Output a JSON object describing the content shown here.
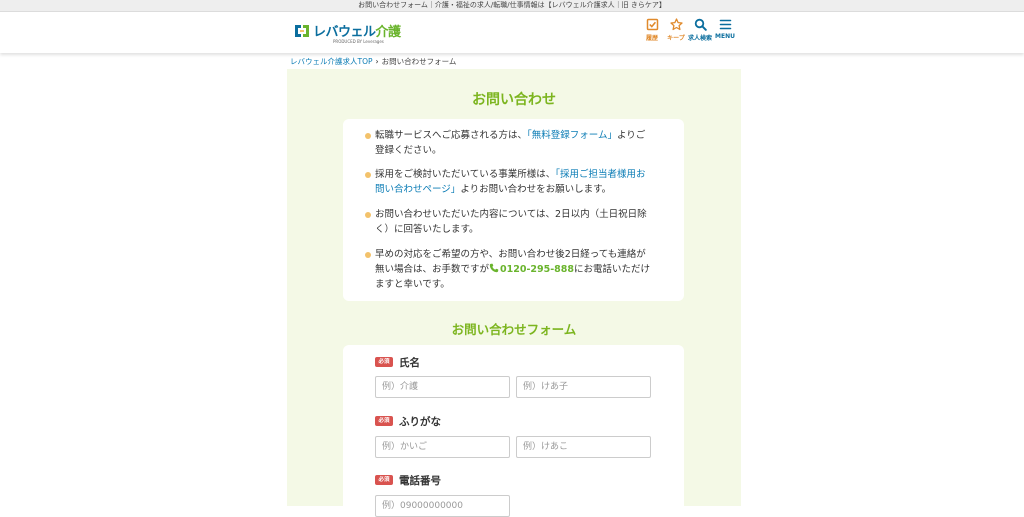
{
  "browser_title": "お問い合わせフォーム｜介護・福祉の求人/転職/仕事情報は【レバウェル介護求人｜旧 きらケア】",
  "header": {
    "logo_text_main": "レバウェル",
    "logo_text_accent": "介護",
    "logo_sub": "PRODUCED BY Leverages",
    "nav": {
      "history_label": "履歴",
      "keep_label": "キープ",
      "search_label": "求人検索",
      "menu_label": "MENU"
    }
  },
  "breadcrumb": {
    "home": "レバウェル介護求人TOP",
    "current": "お問い合わせフォーム"
  },
  "page_title": "お問い合わせ",
  "notices": {
    "n1_a": "転職サービスへご応募される方は、",
    "n1_link": "「無料登録フォーム」",
    "n1_b": "よりご登録ください。",
    "n2_a": "採用をご検討いただいている事業所様は、",
    "n2_link": "「採用ご担当者様用お問い合わせページ」",
    "n2_b": "よりお問い合わせをお願いします。",
    "n3": "お問い合わせいただいた内容については、2日以内（土日祝日除く）に回答いたします。",
    "n4_a": "早めの対応をご希望の方や、お問い合わせ後2日経っても連絡が無い場合は、お手数ですが",
    "n4_tel": "0120-295-888",
    "n4_b": "にお電話いただけますと幸いです。"
  },
  "form": {
    "title": "お問い合わせフォーム",
    "required_badge": "必須",
    "name": {
      "label": "氏名",
      "last_placeholder": "例）介護",
      "first_placeholder": "例）けあ子",
      "last_value": "",
      "first_value": ""
    },
    "kana": {
      "label": "ふりがな",
      "last_placeholder": "例）かいご",
      "first_placeholder": "例）けあこ",
      "last_value": "",
      "first_value": ""
    },
    "phone": {
      "label": "電話番号",
      "placeholder": "例）09000000000",
      "value": ""
    }
  },
  "colors": {
    "accent_green": "#7cb51f",
    "link_blue": "#0b7cb5",
    "brand_blue": "#0b6e9e",
    "nav_orange": "#e08a2c",
    "required_red": "#d9534f",
    "main_bg": "#f4f9e6"
  },
  "icons": {
    "history": "check-square-icon",
    "keep": "star-icon",
    "search": "search-icon",
    "menu": "hamburger-icon",
    "phone": "phone-icon"
  }
}
